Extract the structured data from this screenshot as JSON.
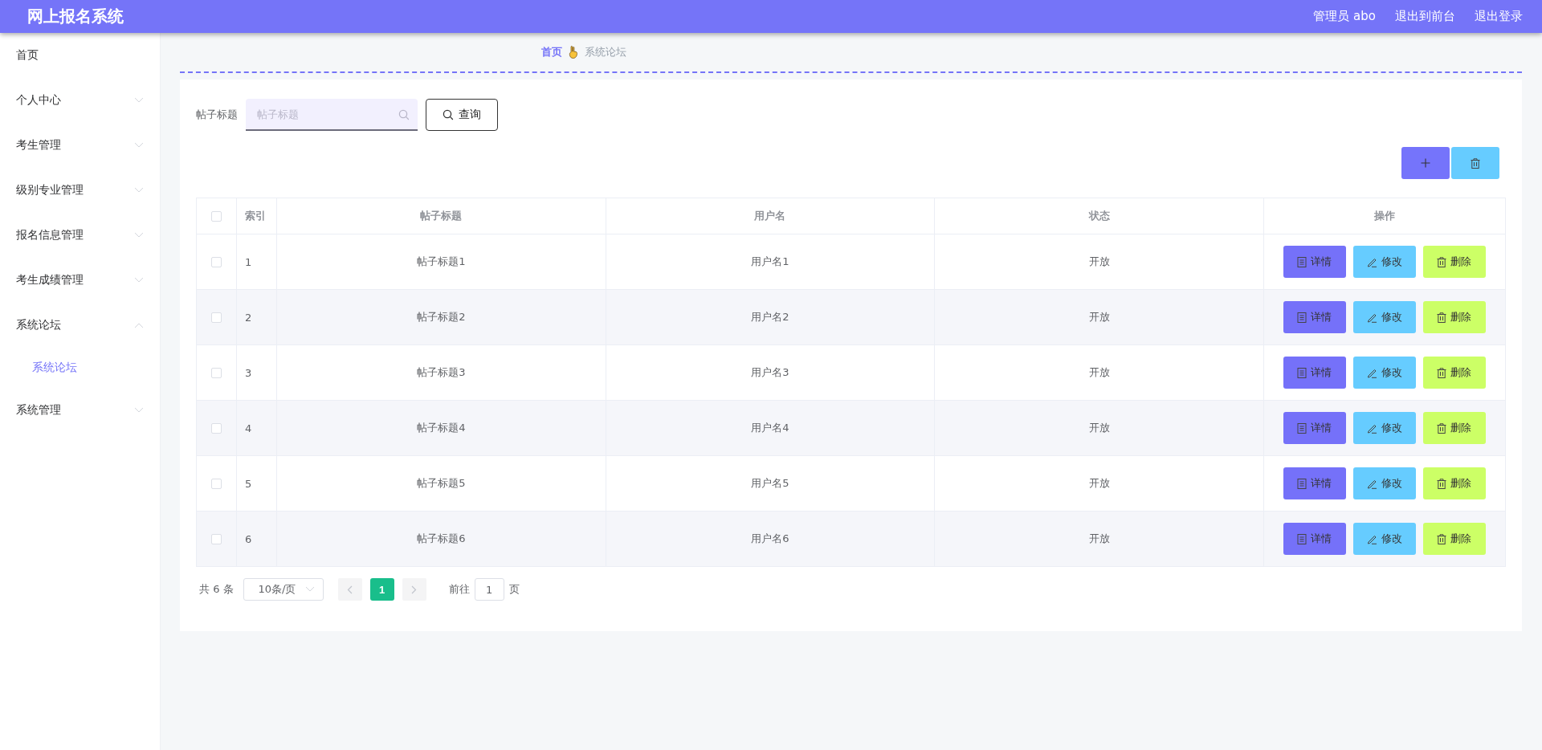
{
  "header": {
    "title": "网上报名系统",
    "links": [
      "管理员 abo",
      "退出到前台",
      "退出登录"
    ]
  },
  "sidebar": {
    "items": [
      {
        "label": "首页",
        "kind": "link"
      },
      {
        "label": "个人中心",
        "kind": "menu",
        "expanded": false
      },
      {
        "label": "考生管理",
        "kind": "menu",
        "expanded": false
      },
      {
        "label": "级别专业管理",
        "kind": "menu",
        "expanded": false
      },
      {
        "label": "报名信息管理",
        "kind": "menu",
        "expanded": false
      },
      {
        "label": "考生成绩管理",
        "kind": "menu",
        "expanded": false
      },
      {
        "label": "系统论坛",
        "kind": "menu",
        "expanded": true,
        "children": [
          {
            "label": "系统论坛",
            "selected": true
          }
        ]
      },
      {
        "label": "系统管理",
        "kind": "menu",
        "expanded": false
      }
    ]
  },
  "breadcrumb": [
    "首页",
    "系统论坛"
  ],
  "search": {
    "label": "帖子标题",
    "placeholder": "帖子标题",
    "button": "查询"
  },
  "table": {
    "all_checked": false,
    "columns": [
      "索引",
      "帖子标题",
      "用户名",
      "状态",
      "操作"
    ],
    "rows": [
      {
        "checked": false,
        "index": "1",
        "title": "帖子标题1",
        "username": "用户名1",
        "status": "开放",
        "actions": [
          {
            "kind": "detail",
            "label": "详情"
          },
          {
            "kind": "edit",
            "label": "修改"
          },
          {
            "kind": "delete",
            "label": "删除"
          }
        ]
      },
      {
        "checked": false,
        "index": "2",
        "title": "帖子标题2",
        "username": "用户名2",
        "status": "开放",
        "actions": [
          {
            "kind": "detail",
            "label": "详情"
          },
          {
            "kind": "edit",
            "label": "修改"
          },
          {
            "kind": "delete",
            "label": "删除"
          }
        ]
      },
      {
        "checked": false,
        "index": "3",
        "title": "帖子标题3",
        "username": "用户名3",
        "status": "开放",
        "actions": [
          {
            "kind": "detail",
            "label": "详情"
          },
          {
            "kind": "edit",
            "label": "修改"
          },
          {
            "kind": "delete",
            "label": "删除"
          }
        ]
      },
      {
        "checked": false,
        "index": "4",
        "title": "帖子标题4",
        "username": "用户名4",
        "status": "开放",
        "actions": [
          {
            "kind": "detail",
            "label": "详情"
          },
          {
            "kind": "edit",
            "label": "修改"
          },
          {
            "kind": "delete",
            "label": "删除"
          }
        ]
      },
      {
        "checked": false,
        "index": "5",
        "title": "帖子标题5",
        "username": "用户名5",
        "status": "开放",
        "actions": [
          {
            "kind": "detail",
            "label": "详情"
          },
          {
            "kind": "edit",
            "label": "修改"
          },
          {
            "kind": "delete",
            "label": "删除"
          }
        ]
      },
      {
        "checked": false,
        "index": "6",
        "title": "帖子标题6",
        "username": "用户名6",
        "status": "开放",
        "actions": [
          {
            "kind": "detail",
            "label": "详情"
          },
          {
            "kind": "edit",
            "label": "修改"
          },
          {
            "kind": "delete",
            "label": "删除"
          }
        ]
      }
    ]
  },
  "pagination": {
    "total": "共 6 条",
    "page_size": "10条/页",
    "pages": [
      {
        "label": "1",
        "selected": true
      }
    ],
    "goto_label": "前往",
    "goto_value": "1",
    "goto_suffix": "页"
  }
}
